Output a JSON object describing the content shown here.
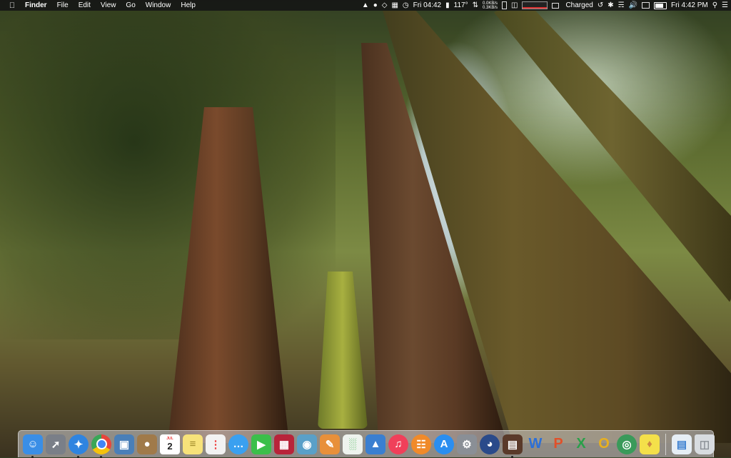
{
  "menubar": {
    "apple_icon": "apple-icon",
    "app_name": "Finder",
    "menus": [
      "File",
      "Edit",
      "View",
      "Go",
      "Window",
      "Help"
    ],
    "status": {
      "clock_short": "Fri 04:42",
      "temperature": "117°",
      "net_down": "0.0KB/s",
      "net_up": "0.3KB/s",
      "battery_status": "Charged",
      "clock_full": "Fri 4:42 PM"
    }
  },
  "dock": {
    "calendar_month": "JUL",
    "calendar_day": "2",
    "apps": [
      {
        "name": "Finder",
        "icon": "finder-icon",
        "color": "#3a8ee6",
        "running": true
      },
      {
        "name": "Launchpad",
        "icon": "rocket-icon",
        "color": "#7a7f88",
        "running": false
      },
      {
        "name": "Safari",
        "icon": "compass-icon",
        "color": "#2f84e0",
        "running": true
      },
      {
        "name": "Chrome",
        "icon": "chrome-icon",
        "color": "#e8453c",
        "running": true
      },
      {
        "name": "Preview",
        "icon": "photo-icon",
        "color": "#4a7fb8",
        "running": false
      },
      {
        "name": "Contacts",
        "icon": "contacts-icon",
        "color": "#a07a4a",
        "running": false
      },
      {
        "name": "Calendar",
        "icon": "calendar-icon",
        "color": "#ffffff",
        "running": false
      },
      {
        "name": "Notes",
        "icon": "notes-icon",
        "color": "#f7e27a",
        "running": false
      },
      {
        "name": "Reminders",
        "icon": "reminders-icon",
        "color": "#f2f2f2",
        "running": false
      },
      {
        "name": "Messages",
        "icon": "messages-icon",
        "color": "#3aa0f0",
        "running": false
      },
      {
        "name": "FaceTime",
        "icon": "facetime-icon",
        "color": "#3bbf4a",
        "running": false
      },
      {
        "name": "Photo Booth",
        "icon": "photobooth-icon",
        "color": "#b8243a",
        "running": false
      },
      {
        "name": "iPhoto",
        "icon": "camera-icon",
        "color": "#5aa0c8",
        "running": false
      },
      {
        "name": "Pages",
        "icon": "pages-icon",
        "color": "#e8903a",
        "running": false
      },
      {
        "name": "Numbers",
        "icon": "chart-icon",
        "color": "#3bb04a",
        "running": false
      },
      {
        "name": "Keynote",
        "icon": "keynote-icon",
        "color": "#3a7fd0",
        "running": false
      },
      {
        "name": "iTunes",
        "icon": "music-icon",
        "color": "#f0405a",
        "running": false
      },
      {
        "name": "iBooks",
        "icon": "book-icon",
        "color": "#f08a2a",
        "running": false
      },
      {
        "name": "App Store",
        "icon": "appstore-icon",
        "color": "#2a8ef0",
        "running": false
      },
      {
        "name": "System Preferences",
        "icon": "gear-icon",
        "color": "#8a8f96",
        "running": false
      },
      {
        "name": "Quicksilver",
        "icon": "gauge-icon",
        "color": "#2a4a8a",
        "running": false
      },
      {
        "name": "Movies",
        "icon": "film-icon",
        "color": "#5a3a2a",
        "running": false
      },
      {
        "name": "Word",
        "icon": "word-icon",
        "color": "#2b6fd8",
        "running": false
      },
      {
        "name": "PowerPoint",
        "icon": "powerpoint-icon",
        "color": "#e0502a",
        "running": false
      },
      {
        "name": "Excel",
        "icon": "excel-icon",
        "color": "#2aa04a",
        "running": false
      },
      {
        "name": "Outlook",
        "icon": "outlook-icon",
        "color": "#e8b020",
        "running": false
      },
      {
        "name": "Network",
        "icon": "globe-icon",
        "color": "#3a9a5a",
        "running": false
      },
      {
        "name": "Stickies",
        "icon": "stickies-icon",
        "color": "#f4e04a",
        "running": false
      }
    ],
    "trailing": [
      {
        "name": "Downloads",
        "icon": "downloads-icon",
        "color": "#e6eef5"
      },
      {
        "name": "Trash",
        "icon": "trash-icon",
        "color": "#d8dce0"
      }
    ]
  }
}
